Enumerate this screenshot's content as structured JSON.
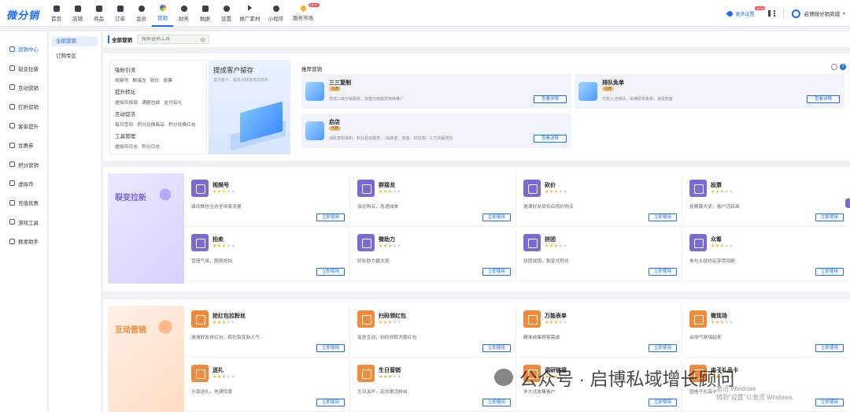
{
  "app": {
    "logo": "微分销",
    "store_name": "启博微分销商城",
    "more_settings": "更多设置",
    "new_badge": "NEW",
    "hot_badge": "HOT"
  },
  "nav": [
    {
      "label": "首页",
      "icon": "home-icon"
    },
    {
      "label": "店铺",
      "icon": "store-icon"
    },
    {
      "label": "商品",
      "icon": "goods-icon"
    },
    {
      "label": "订单",
      "icon": "order-icon"
    },
    {
      "label": "会员",
      "icon": "member-icon"
    },
    {
      "label": "营销",
      "icon": "marketing-icon",
      "active": true
    },
    {
      "label": "财务",
      "icon": "finance-icon"
    },
    {
      "label": "数据",
      "icon": "data-icon"
    },
    {
      "label": "设置",
      "icon": "settings-icon"
    },
    {
      "label": "推广素材",
      "icon": "share-icon"
    },
    {
      "label": "小程序",
      "icon": "miniprogram-icon"
    },
    {
      "label": "服务市场",
      "icon": "market-icon"
    }
  ],
  "sidebar": [
    {
      "label": "营销中心",
      "active": true
    },
    {
      "label": "裂变拉新"
    },
    {
      "label": "互动营销"
    },
    {
      "label": "打折促销"
    },
    {
      "label": "客单提升"
    },
    {
      "label": "优惠券"
    },
    {
      "label": "积分营销"
    },
    {
      "label": "虚拟币"
    },
    {
      "label": "充值优惠"
    },
    {
      "label": "游戏工具"
    },
    {
      "label": "群发助手"
    }
  ],
  "sub_sidebar": [
    {
      "label": "全部营销",
      "active": true
    },
    {
      "label": "订购专区"
    }
  ],
  "filter": {
    "title": "全部营销",
    "search_placeholder": "搜索营销工具"
  },
  "categories": [
    {
      "title": "吸粉引流",
      "links": [
        "视频号",
        "群接龙",
        "砍价",
        "投票"
      ]
    },
    {
      "title": "提升转化",
      "links": [
        "虚拟币抵现",
        "满额包邮",
        "支付有礼"
      ]
    },
    {
      "title": "互动促活",
      "links": [
        "每日签到",
        "积分兑换商品",
        "积分兑换红包"
      ]
    },
    {
      "title": "工具管理",
      "links": [
        "虚拟币日志",
        "积分日志"
      ]
    }
  ],
  "banner": {
    "title": "提成客户留存",
    "subtitle": "激活客户、提高活跃度增加复购"
  },
  "recommend": {
    "title": "推荐营销",
    "badge": "2",
    "cards": [
      {
        "name": "三三复制",
        "tag": "付费",
        "desc": "倍增三级分销裂变，双重分佣激发持续推广",
        "button": "查看详情"
      },
      {
        "name": "排队免单",
        "tag": "付费",
        "desc": "付款入池排队，出满即享免单，速促拓客",
        "button": "查看详情"
      },
      {
        "name": "启店",
        "tag": "付费",
        "desc": "消费复购得积，积分驱动裂变，（消费者、商家、供应商）三方共赢增长",
        "button": "查看详情"
      }
    ]
  },
  "sections": [
    {
      "title": "裂变拉新",
      "tools": [
        {
          "name": "视频号",
          "stars": 3,
          "desc": "撬动微信生态全场景流量",
          "button": "立即使用"
        },
        {
          "name": "群接龙",
          "stars": 3,
          "desc": "接龙购买，急速成单",
          "button": "立即使用"
        },
        {
          "name": "砍价",
          "stars": 3,
          "desc": "邀请好友砍价后低价购买",
          "button": "立即使用"
        },
        {
          "name": "投票",
          "stars": 3,
          "desc": "投票赢大奖，客户活跃高",
          "button": "立即使用"
        },
        {
          "name": "拍卖",
          "stars": 3,
          "desc": "营造气氛，围观抢拍",
          "button": "立即使用"
        },
        {
          "name": "微助力",
          "stars": 3,
          "desc": "好友助力赢大奖",
          "button": "立即使用"
        },
        {
          "name": "拼团",
          "stars": 3,
          "desc": "拼团成团，裂变式转化",
          "button": "立即使用"
        },
        {
          "name": "众筹",
          "stars": 3,
          "desc": "参与人按约定享受回报",
          "button": "立即使用"
        }
      ]
    },
    {
      "title": "互动营销",
      "tools": [
        {
          "name": "抢红包拉粉丝",
          "stars": 3,
          "desc": "邀请好友抢红包，疯狂裂变新人气",
          "button": "立即使用"
        },
        {
          "name": "扫码领红包",
          "stars": 3,
          "desc": "促进互动，扫码领取大额红包",
          "button": "立即使用"
        },
        {
          "name": "万能表单",
          "stars": 3,
          "desc": "精准收集顾客需求",
          "button": "立即使用"
        },
        {
          "name": "微现场",
          "stars": 3,
          "desc": "会场气氛嗨起来",
          "button": "立即使用"
        },
        {
          "name": "送礼",
          "stars": 3,
          "desc": "分享送礼，充满惊喜",
          "button": "立即使用"
        },
        {
          "name": "生日营销",
          "stars": 3,
          "desc": "生日关怀，定向激活粉丝",
          "button": "立即使用"
        },
        {
          "name": "调研链接",
          "stars": 3,
          "desc": "多方式收集客户",
          "button": "立即使用"
        },
        {
          "name": "电子礼品卡",
          "stars": 3,
          "desc": "国电子礼品卡",
          "button": "立即使用"
        }
      ]
    }
  ],
  "watermark": {
    "text": "公众号 · 启博私域增长顾问"
  },
  "windows_activation": {
    "line1": "激活 Windows",
    "line2": "转到\"设置\"以激活 Windows."
  },
  "colors": {
    "accent": "#1a6cff",
    "section1": "#7a6ad6",
    "section2": "#f28a3c",
    "star": "#f5b32a"
  }
}
